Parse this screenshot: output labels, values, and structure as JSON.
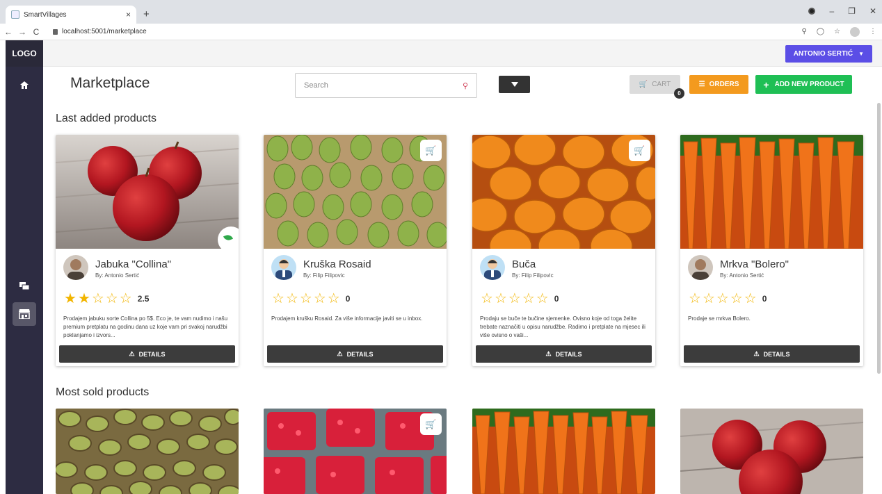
{
  "browser": {
    "tab_title": "SmartVillages",
    "tab_close": "×",
    "new_tab": "+",
    "url": "localhost:5001/marketplace",
    "back": "←",
    "forward": "→",
    "reload": "C"
  },
  "sidebar": {
    "logo": "LOGO"
  },
  "topbar": {
    "user": "ANTONIO SERTIĆ"
  },
  "page": {
    "title": "Marketplace",
    "search_placeholder": "Search",
    "cart_label": "CART",
    "cart_count": "0",
    "orders_label": "ORDERS",
    "add_label": "ADD NEW PRODUCT"
  },
  "sections": {
    "last_added": "Last added products",
    "most_sold": "Most sold products"
  },
  "details_label": "DETAILS",
  "last_added_products": [
    {
      "name": "Jabuka \"Collina\"",
      "by": "By: Antonio Sertić",
      "rating": "2.5",
      "stars_filled": 2,
      "description": "Prodajem jabuku sorte Collina po 5$. Eco je, te vam nudimo i našu premium pretplatu na godinu dana uz koje vam pri svakoj narudžbi poklanjamo i izvors..."
    },
    {
      "name": "Kruška Rosaid",
      "by": "By: Filip Filipovic",
      "rating": "0",
      "stars_filled": 0,
      "description": "Prodajem krušku Rosaid. Za više informacije javiti se u inbox."
    },
    {
      "name": "Buča",
      "by": "By: Filip Filipovic",
      "rating": "0",
      "stars_filled": 0,
      "description": "Prodaju se buče te bučine sjemenke. Ovisno koje od toga želite trebate naznačiti u opisu narudžbe. Radimo i pretplate na mjesec ili više ovisno o vaši..."
    },
    {
      "name": "Mrkva \"Bolero\"",
      "by": "By: Antonio Sertić",
      "rating": "0",
      "stars_filled": 0,
      "description": "Prodaje se mrkva Bolero."
    }
  ],
  "colors": {
    "sidebar": "#2d2c42",
    "user_button": "#5b4ee6",
    "orders": "#f39a1e",
    "add": "#1fbf55",
    "star": "#f2b500"
  }
}
